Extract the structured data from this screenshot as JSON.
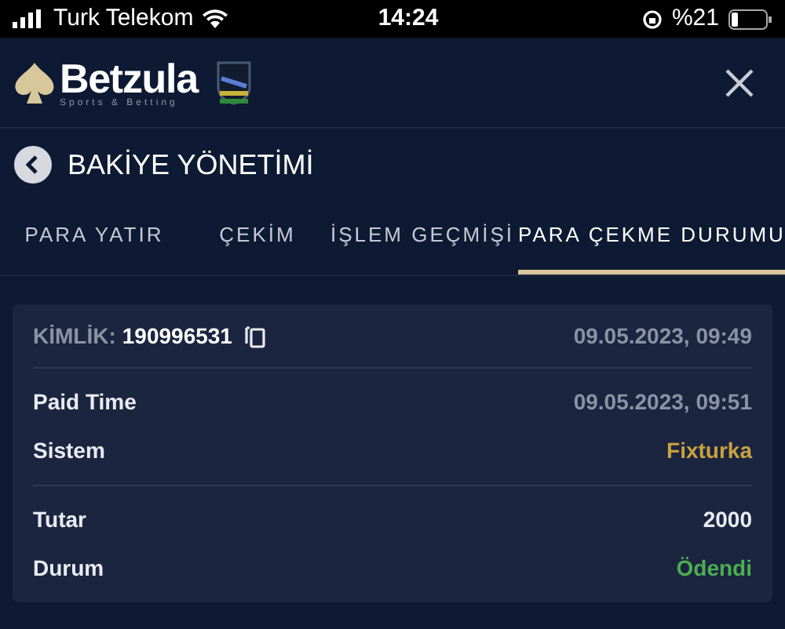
{
  "status_bar": {
    "carrier": "Turk Telekom",
    "time": "14:24",
    "battery": "%21"
  },
  "header": {
    "brand": "Betzula",
    "tagline": "Sports & Betting"
  },
  "page": {
    "title": "BAKİYE YÖNETİMİ"
  },
  "tabs": [
    {
      "label": "PARA YATIR",
      "selected": false
    },
    {
      "label": "ÇEKİM",
      "selected": false
    },
    {
      "label": "İŞLEM GEÇMİŞİ",
      "selected": false
    },
    {
      "label": "PARA ÇEKME DURUMU",
      "selected": true
    }
  ],
  "record": {
    "id_label": "KİMLİK:",
    "id": "190996531",
    "date": "09.05.2023, 09:49",
    "groups": [
      [
        {
          "label": "Paid Time",
          "value": "09.05.2023, 09:51",
          "color": "#8a93a6"
        },
        {
          "label": "Sistem",
          "value": "Fixturka",
          "color": "#c9a23f"
        }
      ],
      [
        {
          "label": "Tutar",
          "value": "2000",
          "color": "#e8ebf2"
        },
        {
          "label": "Durum",
          "value": "Ödendi",
          "color": "#4caf50"
        }
      ]
    ]
  }
}
